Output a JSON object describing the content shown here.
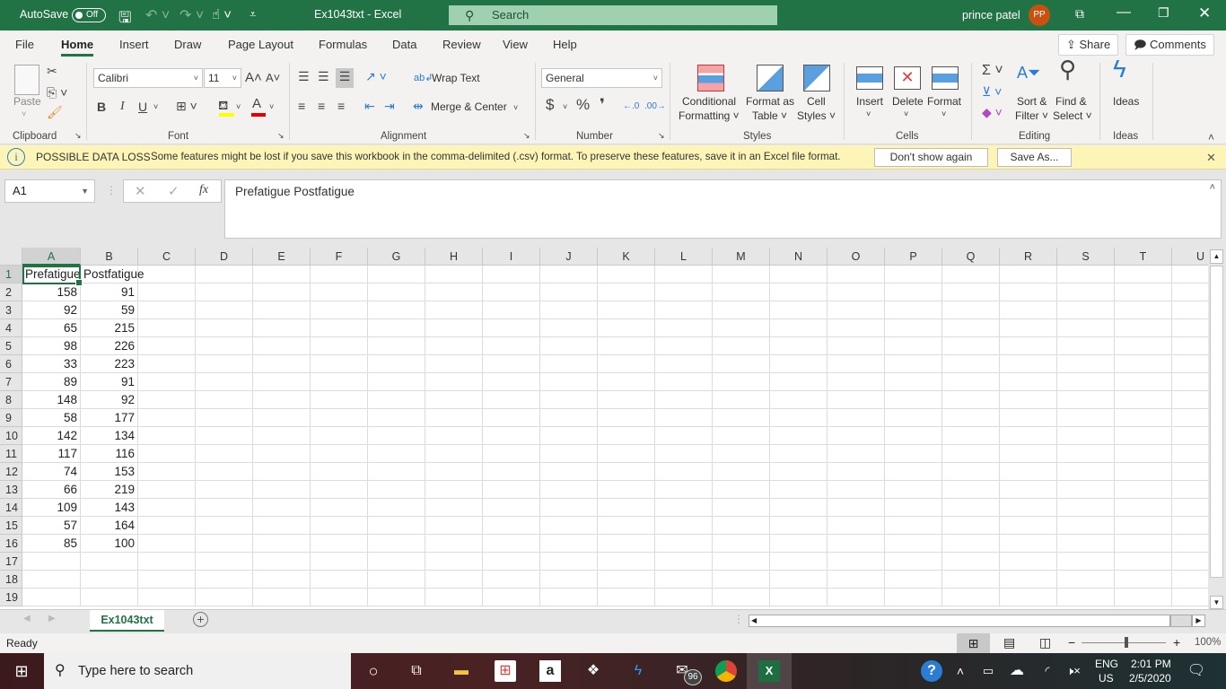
{
  "titlebar": {
    "autosave_label": "AutoSave",
    "autosave_state": "Off",
    "document_title": "Ex1043txt  -  Excel",
    "search_placeholder": "Search",
    "user_name": "prince patel",
    "user_initials": "PP"
  },
  "menu_tabs": [
    "File",
    "Home",
    "Insert",
    "Draw",
    "Page Layout",
    "Formulas",
    "Data",
    "Review",
    "View",
    "Help"
  ],
  "active_tab": "Home",
  "share_label": "Share",
  "comments_label": "Comments",
  "ribbon": {
    "clipboard": {
      "paste": "Paste",
      "group": "Clipboard"
    },
    "font": {
      "font_name": "Calibri",
      "font_size": "11",
      "bold": "B",
      "italic": "I",
      "underline": "U",
      "group": "Font",
      "highlight_color": "#ffff00",
      "font_color": "#e00000"
    },
    "alignment": {
      "wrap_text": "Wrap Text",
      "merge_center": "Merge & Center",
      "group": "Alignment"
    },
    "number": {
      "format": "General",
      "currency": "$",
      "percent": "%",
      "comma": "❜",
      "group": "Number"
    },
    "styles": {
      "conditional": [
        "Conditional",
        "Formatting ˅"
      ],
      "format_table": [
        "Format as",
        "Table ˅"
      ],
      "cell_styles": [
        "Cell",
        "Styles ˅"
      ],
      "group": "Styles"
    },
    "cells": {
      "insert": "Insert",
      "delete": "Delete",
      "format": "Format",
      "group": "Cells"
    },
    "editing": {
      "sort": [
        "Sort &",
        "Filter ˅"
      ],
      "find": [
        "Find &",
        "Select ˅"
      ],
      "group": "Editing"
    },
    "ideas": {
      "label": "Ideas",
      "group": "Ideas"
    }
  },
  "infobar": {
    "title": "POSSIBLE DATA LOSS",
    "message": "Some features might be lost if you save this workbook in the comma-delimited (.csv) format. To preserve these features, save it in an Excel file format.",
    "dont_show": "Don't show again",
    "save_as": "Save As..."
  },
  "formula_bar": {
    "name_box": "A1",
    "content": "Prefatigue Postfatigue"
  },
  "columns": [
    "A",
    "B",
    "C",
    "D",
    "E",
    "F",
    "G",
    "H",
    "I",
    "J",
    "K",
    "L",
    "M",
    "N",
    "O",
    "P",
    "Q",
    "R",
    "S",
    "T",
    "U"
  ],
  "rows": [
    "1",
    "2",
    "3",
    "4",
    "5",
    "6",
    "7",
    "8",
    "9",
    "10",
    "11",
    "12",
    "13",
    "14",
    "15",
    "16",
    "17",
    "18",
    "19"
  ],
  "sheet": {
    "header": [
      "Prefatigue",
      "Postfatigue"
    ],
    "data": [
      [
        "158",
        "91"
      ],
      [
        "92",
        "59"
      ],
      [
        "65",
        "215"
      ],
      [
        "98",
        "226"
      ],
      [
        "33",
        "223"
      ],
      [
        "89",
        "91"
      ],
      [
        "148",
        "92"
      ],
      [
        "58",
        "177"
      ],
      [
        "142",
        "134"
      ],
      [
        "117",
        "116"
      ],
      [
        "74",
        "153"
      ],
      [
        "66",
        "219"
      ],
      [
        "109",
        "143"
      ],
      [
        "57",
        "164"
      ],
      [
        "85",
        "100"
      ]
    ]
  },
  "sheet_tab": "Ex1043txt",
  "status": {
    "ready": "Ready",
    "zoom": "100%",
    "zoom_level_percent": 100
  },
  "taskbar": {
    "search_placeholder": "Type here to search",
    "mail_badge": "96",
    "lang": "ENG",
    "region": "US",
    "time": "2:01 PM",
    "date": "2/5/2020"
  }
}
